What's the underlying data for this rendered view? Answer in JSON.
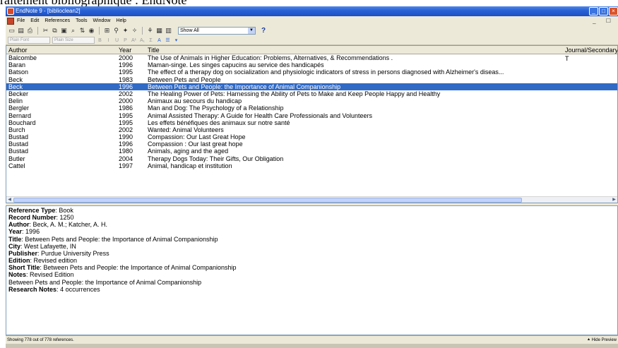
{
  "caption": "raitement bibliographique : EndNote",
  "window": {
    "title": "EndNote 9 - [biblioclean2]"
  },
  "menu": [
    "File",
    "Edit",
    "References",
    "Tools",
    "Window",
    "Help"
  ],
  "toolbar": {
    "show_all": "Show All",
    "help": "?"
  },
  "format_bar": {
    "font": "Plain Font",
    "size": "Plain Size"
  },
  "columns": {
    "author": "Author",
    "year": "Year",
    "title": "Title",
    "journal": "Journal/Secondary T"
  },
  "rows": [
    {
      "author": "Balcombe",
      "year": "2000",
      "title": "The Use of Animals in Higher Education: Problems, Alternatives, & Recommendations ."
    },
    {
      "author": "Baran",
      "year": "1996",
      "title": "Maman-singe. Les singes capucins au service des handicapés"
    },
    {
      "author": "Batson",
      "year": "1995",
      "title": "The effect of a therapy dog on socialization and physiologic indicators of stress in persons diagnosed with Alzheimer's diseas..."
    },
    {
      "author": "Beck",
      "year": "1983",
      "title": "Between Pets and People"
    },
    {
      "author": "Beck",
      "year": "1996",
      "title": "Between Pets and People: the Importance of Animal Companionship"
    },
    {
      "author": "Becker",
      "year": "2002",
      "title": "The Healing Power of Pets: Harnessing the Ability of Pets to Make and Keep People Happy and Healthy"
    },
    {
      "author": "Belin",
      "year": "2000",
      "title": "Animaux au secours du handicap"
    },
    {
      "author": "Bergler",
      "year": "1986",
      "title": "Man and Dog: The Psychology of a Relationship"
    },
    {
      "author": "Bernard",
      "year": "1995",
      "title": "Animal Assisted Therapy: A Guide for Health Care Professionals and Volunteers"
    },
    {
      "author": "Bouchard",
      "year": "1995",
      "title": "Les effets bénéfiques des animaux sur notre santé"
    },
    {
      "author": "Burch",
      "year": "2002",
      "title": "Wanted: Animal Volunteers"
    },
    {
      "author": "Bustad",
      "year": "1990",
      "title": "Compassion: Our Last Great Hope"
    },
    {
      "author": "Bustad",
      "year": "1996",
      "title": "Compassion : Our last great hope"
    },
    {
      "author": "Bustad",
      "year": "1980",
      "title": "Animals, aging and the aged"
    },
    {
      "author": "Butler",
      "year": "2004",
      "title": "Therapy Dogs Today: Their Gifts, Our Obligation"
    },
    {
      "author": "Cattel",
      "year": "1997",
      "title": "Animal, handicap et institution"
    }
  ],
  "preview": {
    "reference_type": {
      "label": "Reference Type",
      "value": "Book"
    },
    "record_number": {
      "label": "Record Number",
      "value": "1250"
    },
    "author": {
      "label": "Author",
      "value": "Beck, A. M.; Katcher, A. H."
    },
    "year": {
      "label": "Year",
      "value": "1996"
    },
    "title": {
      "label": "Title",
      "value": "Between Pets and People: the Importance of Animal Companionship"
    },
    "city": {
      "label": "City",
      "value": "West Lafayette, IN"
    },
    "publisher": {
      "label": "Publisher",
      "value": "Purdue University Press"
    },
    "edition": {
      "label": "Edition",
      "value": "Revised edition"
    },
    "short_title": {
      "label": "Short Title",
      "value": "Between Pets and People: the Importance of Animal Companionship"
    },
    "notes": {
      "label": "Notes",
      "value": "Revised Edition"
    },
    "notes_extra": "Between Pets and People: the Importance of Animal Companionship",
    "research_notes": {
      "label": "Research Notes",
      "value": "4 occurrences"
    }
  },
  "status": {
    "text": "Showing 778 out of 778 references.",
    "hide_preview": "Hide Preview"
  },
  "colors": {
    "selection": "#316ac5",
    "titlebar": "#2a62d6"
  }
}
